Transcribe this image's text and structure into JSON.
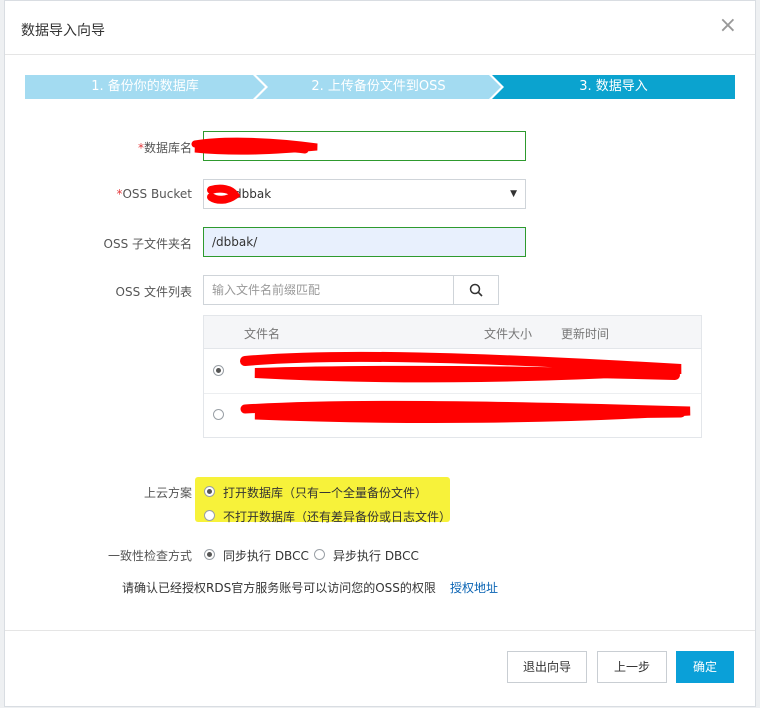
{
  "dialog": {
    "title": "数据导入向导",
    "close": "×"
  },
  "steps": [
    {
      "label": "1. 备份你的数据库"
    },
    {
      "label": "2. 上传备份文件到OSS"
    },
    {
      "label": "3. 数据导入"
    }
  ],
  "colors": {
    "step_done": "#a3dbf1",
    "step_active": "#0ba3cf",
    "highlight": "#f7f23a",
    "primary": "#0aa0d8"
  },
  "form": {
    "db_name_label": "数据库名",
    "required_mark": "*",
    "oss_bucket_label": "OSS Bucket",
    "oss_bucket_value": "dbbak",
    "oss_folder_label": "OSS 子文件夹名",
    "oss_folder_value": "/dbbak/",
    "file_list_label": "OSS 文件列表",
    "search_placeholder": "输入文件名前缀匹配",
    "cloud_plan_label": "上云方案",
    "plan_option_1": "打开数据库（只有一个全量备份文件）",
    "plan_option_2": "不打开数据库（还有差异备份或日志文件）",
    "consistency_label": "一致性检查方式",
    "dbcc_sync": "同步执行 DBCC",
    "dbcc_async": "异步执行 DBCC",
    "confirm_text": "请确认已经授权RDS官方服务账号可以访问您的OSS的权限",
    "auth_link": "授权地址"
  },
  "table": {
    "headers": {
      "name": "文件名",
      "size": "文件大小",
      "time": "更新时间"
    }
  },
  "buttons": {
    "exit": "退出向导",
    "prev": "上一步",
    "ok": "确定"
  },
  "icons": {
    "search": "search-icon",
    "dropdown": "chevron-down-icon",
    "close": "close-icon"
  }
}
